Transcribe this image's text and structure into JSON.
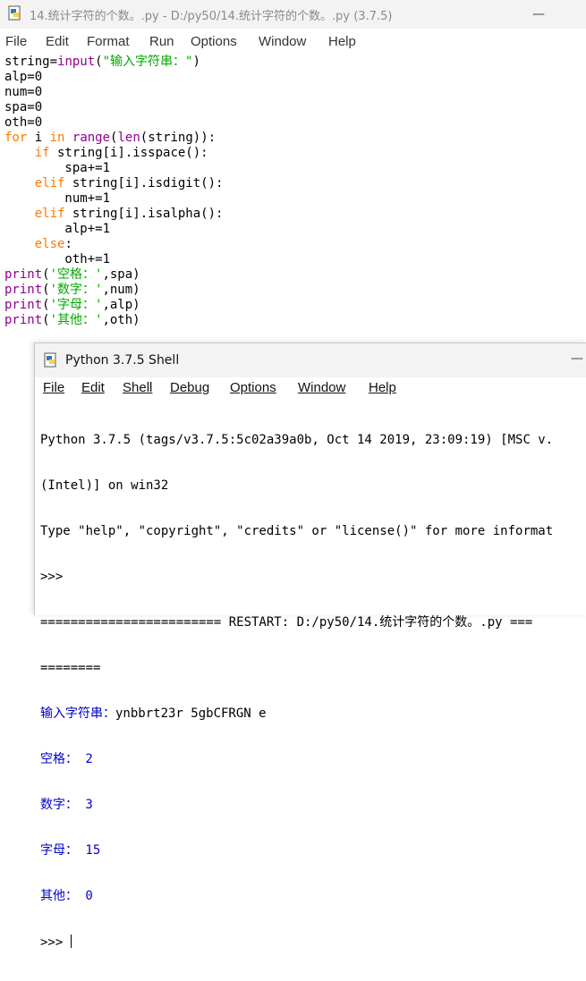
{
  "editor_window": {
    "title": "14.统计字符的个数。.py - D:/py50/14.统计字符的个数。.py (3.7.5)",
    "minimize": "—",
    "menu": [
      "File",
      "Edit",
      "Format",
      "Run",
      "Options",
      "Window",
      "Help"
    ],
    "code": {
      "l1_a": "string=",
      "l1_b": "input",
      "l1_c": "(",
      "l1_d": "\"输入字符串：\"",
      "l1_e": ")",
      "l2": "alp=0",
      "l3": "num=0",
      "l4": "spa=0",
      "l5": "oth=0",
      "l6_for": "for",
      "l6_i": " i ",
      "l6_in": "in",
      "l6_sp": " ",
      "l6_range": "range",
      "l6_p": "(",
      "l6_len": "len",
      "l6_end": "(string)):",
      "l7_ind": "    ",
      "l7_if": "if",
      "l7_rest": " string[i].isspace():",
      "l8": "        spa+=1",
      "l9_ind": "    ",
      "l9_elif": "elif",
      "l9_rest": " string[i].isdigit():",
      "l10": "        num+=1",
      "l11_ind": "    ",
      "l11_elif": "elif",
      "l11_rest": " string[i].isalpha():",
      "l12": "        alp+=1",
      "l13_ind": "    ",
      "l13_else": "else",
      "l13_colon": ":",
      "l14": "        oth+=1",
      "p1_fn": "print",
      "p1_o": "(",
      "p1_s": "'空格：'",
      "p1_r": ",spa)",
      "p2_fn": "print",
      "p2_o": "(",
      "p2_s": "'数字：'",
      "p2_r": ",num)",
      "p3_fn": "print",
      "p3_o": "(",
      "p3_s": "'字母：'",
      "p3_r": ",alp)",
      "p4_fn": "print",
      "p4_o": "(",
      "p4_s": "'其他：'",
      "p4_r": ",oth)"
    }
  },
  "shell_window": {
    "title": "Python 3.7.5 Shell",
    "minimize": "—",
    "menu": [
      "File",
      "Edit",
      "Shell",
      "Debug",
      "Options",
      "Window",
      "Help"
    ],
    "lines": {
      "banner1": "Python 3.7.5 (tags/v3.7.5:5c02a39a0b, Oct 14 2019, 23:09:19) [MSC v.",
      "banner2": "(Intel)] on win32",
      "banner3": "Type \"help\", \"copyright\", \"credits\" or \"license()\" for more informat",
      "prompt1": ">>>",
      "restart1": "======================== RESTART: D:/py50/14.统计字符的个数。.py ===",
      "restart2": "========",
      "input_prompt": "输入字符串：",
      "input_value": "ynbbrt23r 5gbCFRGN e",
      "out1": "空格： 2",
      "out2": "数字： 3",
      "out3": "字母： 15",
      "out4": "其他： 0",
      "prompt2": ">>> "
    }
  },
  "colors": {
    "keyword": "#ff7700",
    "builtin": "#900090",
    "string": "#00aa00",
    "output": "#0000cc"
  }
}
